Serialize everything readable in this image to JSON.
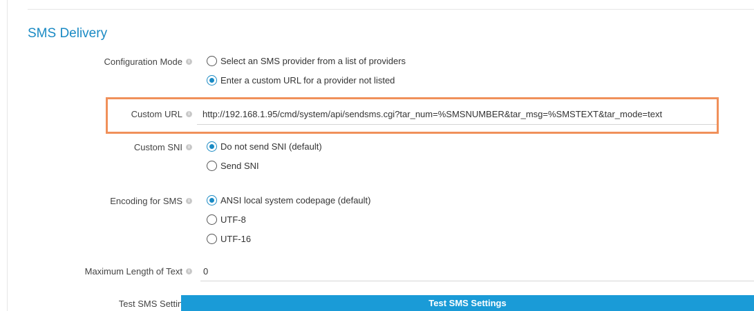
{
  "section_title": "SMS Delivery",
  "config_mode": {
    "label": "Configuration Mode",
    "options": [
      {
        "label": "Select an SMS provider from a list of providers",
        "checked": false
      },
      {
        "label": "Enter a custom URL for a provider not listed",
        "checked": true
      }
    ]
  },
  "custom_url": {
    "label": "Custom URL",
    "value": "http://192.168.1.95/cmd/system/api/sendsms.cgi?tar_num=%SMSNUMBER&tar_msg=%SMSTEXT&tar_mode=text"
  },
  "custom_sni": {
    "label": "Custom SNI",
    "options": [
      {
        "label": "Do not send SNI (default)",
        "checked": true
      },
      {
        "label": "Send SNI",
        "checked": false
      }
    ]
  },
  "encoding": {
    "label": "Encoding for SMS",
    "options": [
      {
        "label": "ANSI local system codepage (default)",
        "checked": true
      },
      {
        "label": "UTF-8",
        "checked": false
      },
      {
        "label": "UTF-16",
        "checked": false
      }
    ]
  },
  "max_length": {
    "label": "Maximum Length of Text",
    "value": "0"
  },
  "test_sms": {
    "label": "Test SMS Settings",
    "button_label": "Test SMS Settings"
  },
  "colors": {
    "accent": "#1a8ac4",
    "button": "#1a9bd7",
    "highlight": "#f0905a"
  }
}
